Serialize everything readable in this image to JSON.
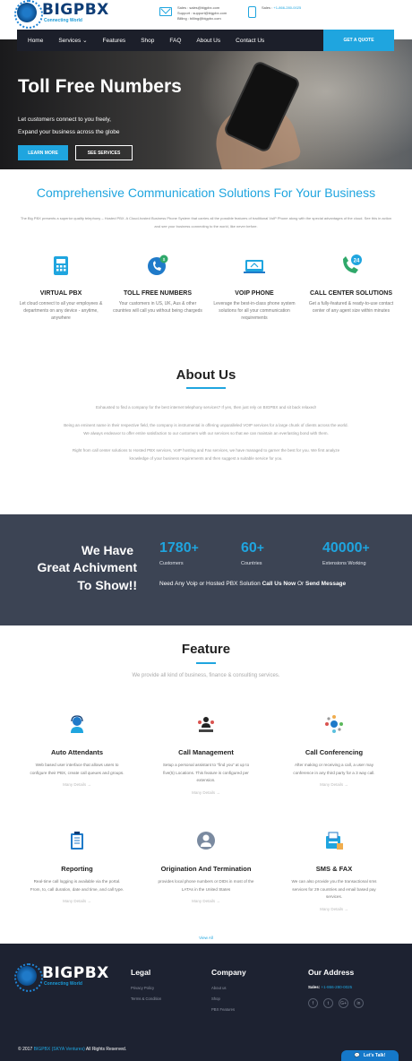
{
  "header": {
    "logo_title": "BIGPBX",
    "logo_tagline": "Connecting World",
    "sales_email": "Sales : sales@bigpbx.com",
    "support_email": "Support : support@bigpbx.com",
    "billing_email": "Billing : billing@bigpbx.com",
    "sales_phone_label": "Sales :",
    "sales_phone": "+1-866-280-0025"
  },
  "nav": {
    "items": [
      "Home",
      "Services ⌄",
      "Features",
      "Shop",
      "FAQ",
      "About Us",
      "Contact Us"
    ],
    "cta": "GET A QUOTE"
  },
  "hero": {
    "title": "Toll Free Numbers",
    "line1": "Let customers connect to you freely,",
    "line2": "Expand your business across the globe",
    "learn_more": "LEARN MORE",
    "see_services": "SEE SERVICES"
  },
  "intro": {
    "title": "Comprehensive Communication Solutions For Your Business",
    "description": "The Big PBX presents a superior quality telephony – Hosted PBX. A Cloud-hosted Business Phone System that carries all the possible features of traditional VoIP Phone along with the special advantages of the cloud. See this in action and see your business connecting to the world, like never before."
  },
  "services": [
    {
      "title": "VIRTUAL PBX",
      "desc": "Let cloud connect to all your employees & departments on any device - anytime, anywhere",
      "icon": "virtual-pbx-icon",
      "color": "#1fa5df"
    },
    {
      "title": "TOLL FREE NUMBERS",
      "desc": "Your customers in US, UK, Aus & other countries will call you without being chargeds",
      "icon": "toll-free-icon",
      "color": "#1f7ac9"
    },
    {
      "title": "VOIP PHONE",
      "desc": "Leverage the best-in-class phone system solutions for all your communication requirements",
      "icon": "voip-phone-icon",
      "color": "#1fa5df"
    },
    {
      "title": "CALL CENTER SOLUTIONS",
      "desc": "Get a fully-featured & ready-to-use contact center of any agent size within minutes",
      "icon": "call-center-icon",
      "color": "#2fa86a"
    }
  ],
  "about": {
    "title": "About Us",
    "p1": "Exhausted to find a company for the best internet telephony services? If yes, then just rely on BIGPBX and sit back relaxed!",
    "p2a": "Being an eminent name in their respective field, the company is instrumental in offering unparalleled VOIP services for a large chunk of clients across the world.",
    "p2b": "We always endeavor to offer entire satisfaction to our customers with our services so that we can maintain an everlasting bond with them.",
    "p3a": "Right from call center solutions to Hosted PBX services, VoIP hosting and Fax services, we have managed to garner the best for you. We first analyze",
    "p3b": "knowledge of your business requirements and then suggest a suitable service for you."
  },
  "achievement": {
    "line1": "We Have",
    "line2": "Great Achivment",
    "line3": "To Show!!",
    "stats": [
      {
        "number": "1780",
        "plus": "+",
        "label": "Customers"
      },
      {
        "number": "60",
        "plus": "+",
        "label": "Countries"
      },
      {
        "number": "40000",
        "plus": "+",
        "label": "Extensions Working"
      }
    ],
    "cta_prefix": "Need Any Voip or Hosted PBX Solution",
    "cta_call": "Call Us Now",
    "cta_or": "Or",
    "cta_send": "Send Message"
  },
  "features": {
    "title": "Feature",
    "subtitle": "We provide all kind of business, finance & consulting services.",
    "more_label": "Many Details →",
    "view_all": "View All",
    "items": [
      {
        "title": "Auto Attendants",
        "desc": "Web based user interface that allows users to configure their PBX, create call queues and groups.",
        "icon": "auto-attendant-icon"
      },
      {
        "title": "Call Management",
        "desc": "Setup a personal assistant to “find you” at up to five(5) Locations. This feature is configured per extension.",
        "icon": "call-management-icon"
      },
      {
        "title": "Call Conferencing",
        "desc": "After making or receiving a call, a user may conference in any third party for a 3 way call.",
        "icon": "call-conferencing-icon"
      },
      {
        "title": "Reporting",
        "desc": "Real-time call logging is available via the portal. From, to, call duration, date and time, and call type.",
        "icon": "reporting-icon"
      },
      {
        "title": "Origination And Termination",
        "desc": "provides local phone numbers or DIDs in most of the LATAs in the United States",
        "icon": "origination-icon"
      },
      {
        "title": "SMS & FAX",
        "desc": "We can also provide you the transactional sms services for 29 countries and email based pay services.",
        "icon": "sms-fax-icon"
      }
    ]
  },
  "footer": {
    "logo_title": "BIGPBX",
    "logo_tagline": "Connecting World",
    "legal_title": "Legal",
    "legal_links": [
      "Privacy Policy",
      "Terms & Condition"
    ],
    "company_title": "Company",
    "company_links": [
      "About us",
      "Shop",
      "PBX Features"
    ],
    "address_title": "Our Address",
    "sales_label": "Sales:",
    "sales_phone": "+1-866-280-0025",
    "social": [
      "f",
      "t",
      "G+",
      "in"
    ],
    "copyright_prefix": "© 2017",
    "copyright_brand": "BIGPBX (SKYA Ventures)",
    "copyright_suffix": "All Rights Reserved.",
    "chat": "Let's Talk!"
  }
}
